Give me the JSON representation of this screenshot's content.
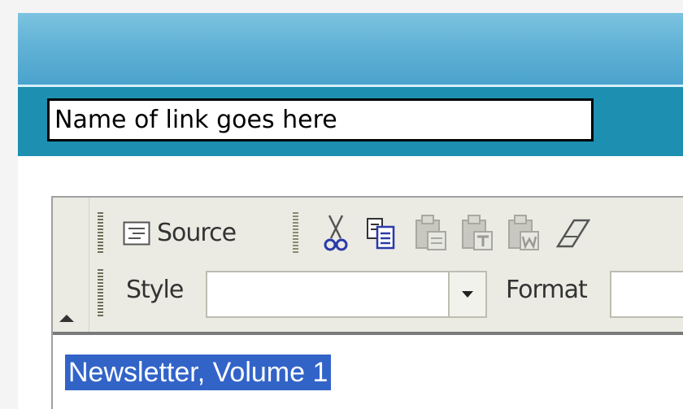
{
  "link": {
    "name_value": "Name of link goes here"
  },
  "toolbar": {
    "source_label": "Source",
    "style_label": "Style",
    "style_value": "",
    "format_label": "Format",
    "format_value": ""
  },
  "editor": {
    "selected_text": "Newsletter, Volume 1"
  },
  "colors": {
    "banner": "#62b2d6",
    "link_bar": "#1d8fb1",
    "selection": "#3264c8",
    "toolbar_bg": "#ebebe4"
  },
  "icons": [
    "source-icon",
    "cut-icon",
    "copy-icon",
    "paste-icon",
    "paste-text-icon",
    "paste-word-icon",
    "eraser-icon",
    "collapse-toolbar-icon"
  ]
}
